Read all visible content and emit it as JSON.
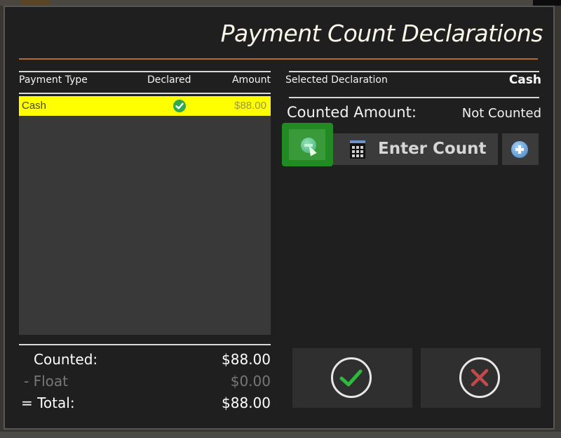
{
  "dialog": {
    "title": "Payment Count Declarations",
    "accent_color": "#b86a26"
  },
  "payment_list": {
    "columns": [
      "Payment Type",
      "Declared",
      "Amount"
    ],
    "rows": [
      {
        "payment_type": "Cash",
        "declared_icon": "check-circle-icon",
        "declared": true,
        "amount": "$88.00",
        "selected": true,
        "highlight_color": "#ffff00"
      }
    ]
  },
  "summary": {
    "counted_label": "Counted:",
    "counted_value": "$88.00",
    "float_label": "- Float",
    "float_value": "$0.00",
    "total_label": "= Total:",
    "total_value": "$88.00"
  },
  "selected_declaration": {
    "label": "Selected Declaration",
    "value": "Cash"
  },
  "counted_amount": {
    "label": "Counted Amount:",
    "value": "Not Counted"
  },
  "buttons": {
    "decrease_icon": "minus-circle-icon",
    "enter_count_label": "Enter Count",
    "enter_count_icon": "calculator-icon",
    "increase_icon": "plus-circle-icon",
    "confirm_icon": "checkmark-icon",
    "cancel_icon": "x-icon",
    "hover_color": "#228a22"
  }
}
